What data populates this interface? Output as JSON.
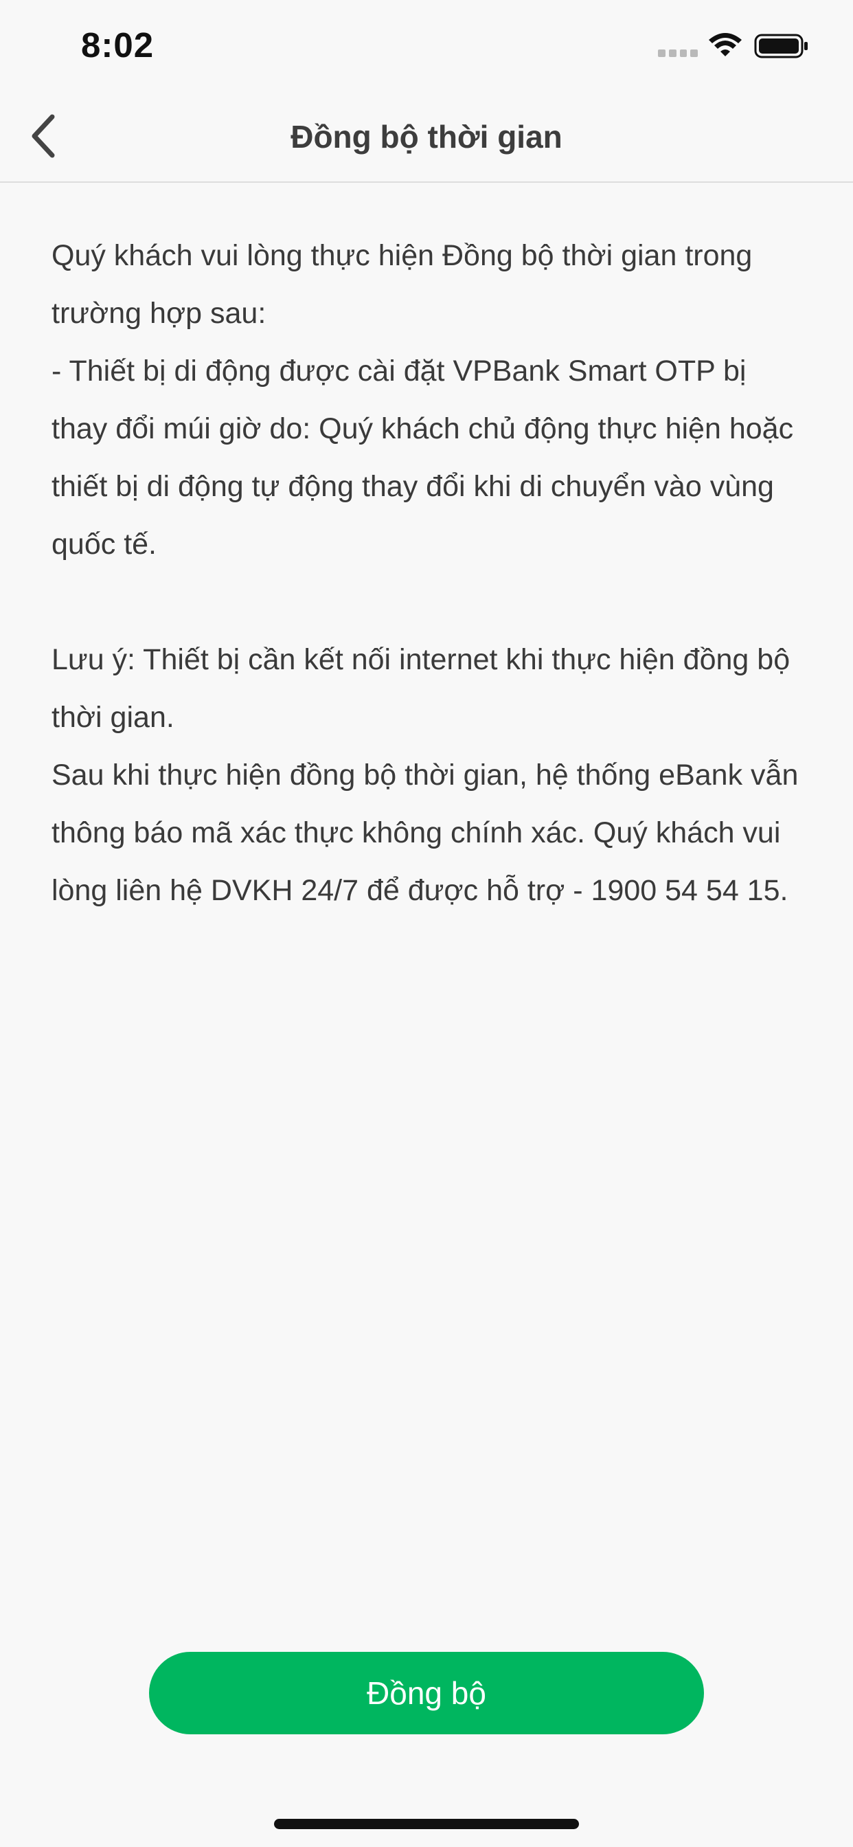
{
  "status_bar": {
    "time": "8:02",
    "icons": [
      "signal-icon",
      "wifi-icon",
      "battery-icon"
    ]
  },
  "nav": {
    "back_icon": "chevron-left-icon",
    "title": "Đồng bộ thời gian"
  },
  "content": {
    "paragraphs": [
      "Quý khách vui lòng thực hiện Đồng bộ thời gian trong trường hợp sau:",
      "- Thiết bị di động được cài đặt VPBank Smart OTP bị thay đổi múi giờ do: Quý khách chủ động thực hiện hoặc thiết bị di động tự động thay đổi khi di chuyển vào vùng quốc tế.",
      "Lưu ý: Thiết bị cần kết nối internet khi thực hiện đồng bộ thời gian.",
      "Sau khi thực hiện đồng bộ thời gian, hệ thống eBank vẫn thông báo mã xác thực không chính xác. Quý khách vui lòng liên hệ DVKH 24/7 để được hỗ trợ - 1900 54 54 15."
    ]
  },
  "actions": {
    "sync_label": "Đồng bộ"
  },
  "colors": {
    "background": "#f8f8f8",
    "accent": "#00b65f",
    "text": "#3a3a3a"
  }
}
